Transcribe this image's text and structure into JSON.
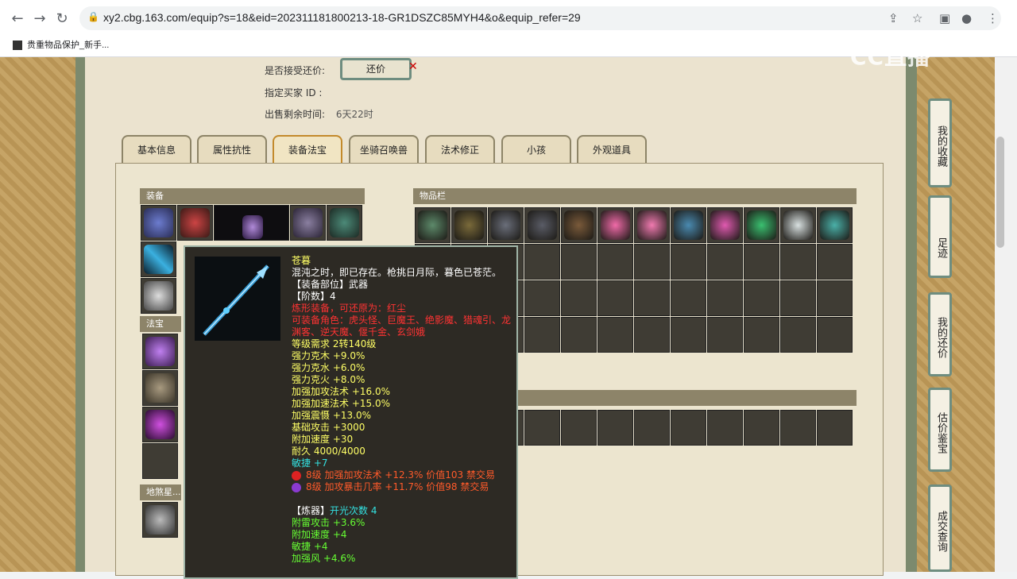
{
  "browser": {
    "url": "xy2.cbg.163.com/equip?s=18&eid=202311181800213-18-GR1DSZC85MYH4&o&equip_refer=29",
    "bookmark": "贵重物品保护_新手..."
  },
  "watermark": "CC直播",
  "info": {
    "accept_bargain_label": "是否接受还价:",
    "bargain_button": "还价",
    "buyer_id_label": "指定买家 ID :",
    "remaining_label": "出售剩余时间:",
    "remaining_value": "6天22时"
  },
  "tabs": [
    "基本信息",
    "属性抗性",
    "装备法宝",
    "坐骑召唤兽",
    "法术修正",
    "小孩",
    "外观道具"
  ],
  "sections": {
    "equipment": "装备",
    "inventory": "物品栏",
    "fabao": "法宝",
    "disha": "地煞星..."
  },
  "tooltip": {
    "name": "苍暮",
    "desc": "混沌之时，即已存在。枪挑日月际，暮色已苍茫。",
    "slot": "【装备部位】武器",
    "tier": "【阶数】4",
    "refine": "炼形装备，可还原为：红尘",
    "roles": "可装备角色：虎头怪、巨魔王、绝影魔、猎魂引、龙渊客、逆天魔、偃千金、玄剑娥",
    "level": "等级需求 2转140级",
    "stats": [
      "强力克木 +9.0%",
      "强力克水 +6.0%",
      "强力克火 +8.0%",
      "加强加攻法术 +16.0%",
      "加强加速法术 +15.0%",
      "加强震慑 +13.0%",
      "基础攻击 +3000",
      "附加速度 +30",
      "耐久 4000/4000"
    ],
    "agility": "敏捷 +7",
    "gems": [
      {
        "text": "8级 加强加攻法术 +12.3% 价值103 禁交易",
        "color": "#d22"
      },
      {
        "text": "8级 加攻暴击几率 +11.7% 价值98 禁交易",
        "color": "#8a3ad0"
      }
    ],
    "refiner_label": "【炼器】",
    "refiner_count": "开光次数 4",
    "refiner_stats": [
      "附雷攻击 +3.6%",
      "附加速度 +4",
      "敏捷 +4",
      "加强风 +4.6%"
    ]
  },
  "right_sidebar": [
    "我的收藏",
    "足迹",
    "我的还价",
    "估价鉴宝",
    "成交查询"
  ]
}
